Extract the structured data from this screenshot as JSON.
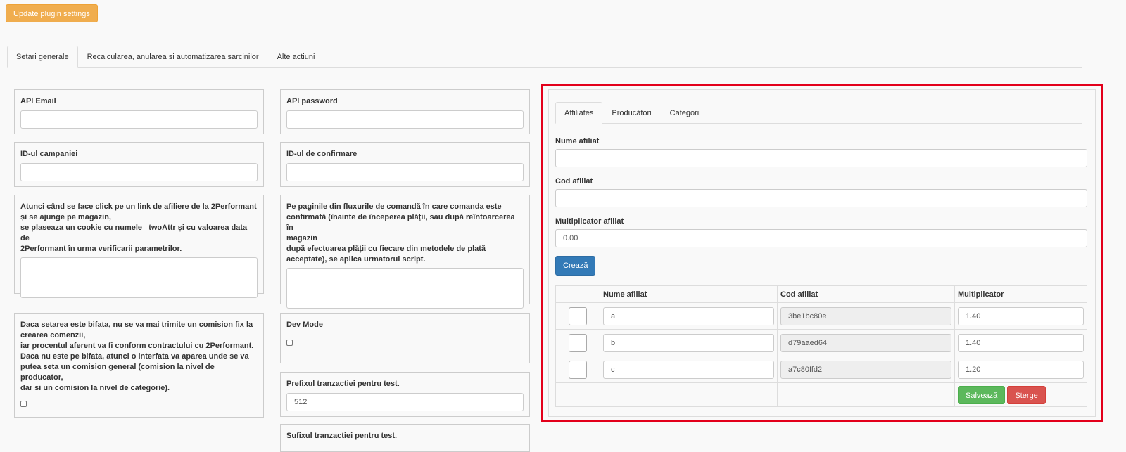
{
  "toolbar": {
    "update_label": "Update plugin settings"
  },
  "main_tabs": [
    {
      "label": "Setari generale",
      "active": true
    },
    {
      "label": "Recalcularea, anularea si automatizarea sarcinilor",
      "active": false
    },
    {
      "label": "Alte actiuni",
      "active": false
    }
  ],
  "general": {
    "api_email": {
      "label": "API Email",
      "value": ""
    },
    "api_password": {
      "label": "API password",
      "value": ""
    },
    "campaign_id": {
      "label": "ID-ul campaniei",
      "value": ""
    },
    "confirmation_id": {
      "label": "ID-ul de confirmare",
      "value": ""
    },
    "cookie_script": {
      "lines": [
        "Atunci când se face click pe un link de afiliere de la 2Performant",
        "și se ajunge pe magazin,",
        "se plaseaza un cookie cu numele _twoAttr și cu valoarea data de",
        "2Performant în urma verificarii parametrilor."
      ],
      "value": ""
    },
    "confirm_script": {
      "lines": [
        "Pe paginile din fluxurile de comandă în care comanda este",
        "confirmată (înainte de începerea plății, sau după reîntoarcerea în",
        "magazin",
        "după efectuarea plății cu fiecare din metodele de plată",
        "acceptate), se aplica urmatorul script."
      ],
      "value": ""
    },
    "fixed_commission": {
      "lines": [
        "Daca setarea este bifata, nu se va mai trimite un comision fix la",
        "crearea comenzii,",
        "iar procentul aferent va fi conform contractului cu 2Performant.",
        "Daca nu este pe bifata, atunci o interfata va aparea unde se va",
        "putea seta un comision general (comision la nivel de producator,",
        "dar si un comision la nivel de categorie)."
      ],
      "checked": false
    },
    "dev_mode": {
      "label": "Dev Mode",
      "checked": false
    },
    "test_prefix": {
      "label": "Prefixul tranzactiei pentru test.",
      "value": "512"
    },
    "test_suffix": {
      "label": "Sufixul tranzactiei pentru test."
    }
  },
  "commission": {
    "tabs": [
      {
        "label": "Affiliates",
        "active": true
      },
      {
        "label": "Producători",
        "active": false
      },
      {
        "label": "Categorii",
        "active": false
      }
    ],
    "form": {
      "name_label": "Nume afiliat",
      "name_value": "",
      "code_label": "Cod afiliat",
      "code_value": "",
      "mult_label": "Multiplicator afiliat",
      "mult_value": "0.00",
      "create_label": "Crează"
    },
    "table": {
      "headers": [
        "",
        "Nume afiliat",
        "Cod afiliat",
        "Multiplicator"
      ],
      "rows": [
        {
          "name": "a",
          "code": "3be1bc80e",
          "multiplier": "1.40"
        },
        {
          "name": "b",
          "code": "d79aaed64",
          "multiplier": "1.40"
        },
        {
          "name": "c",
          "code": "a7c80ffd2",
          "multiplier": "1.20"
        }
      ],
      "save_label": "Salvează",
      "delete_label": "Șterge"
    }
  }
}
